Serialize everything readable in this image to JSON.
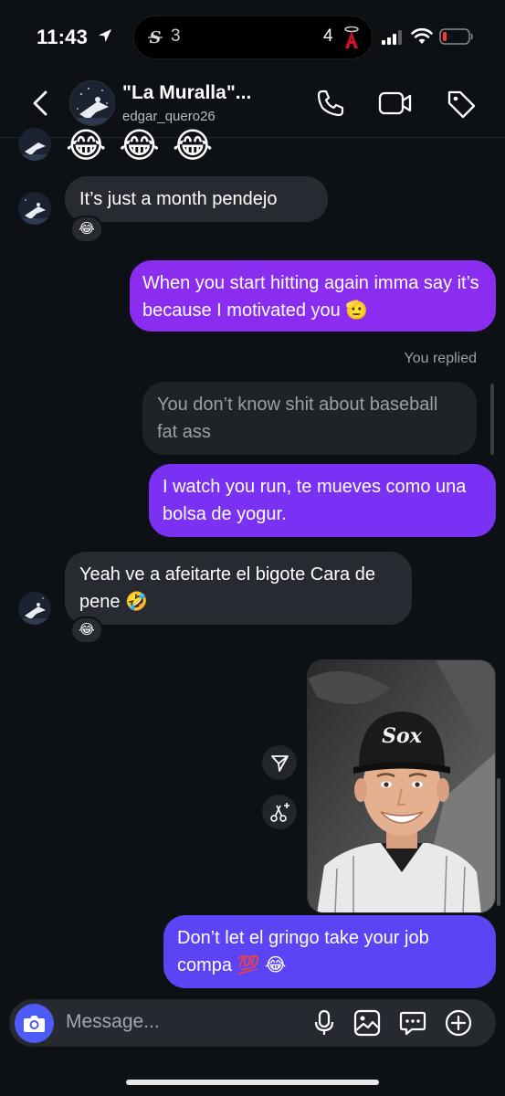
{
  "status_bar": {
    "time": "11:43",
    "score_left": "3",
    "score_right": "4"
  },
  "header": {
    "name": "\"La Muralla\"...",
    "username": "edgar_quero26"
  },
  "messages": {
    "top_emojis": "😂😂😂",
    "m1": "It’s just a month pendejo",
    "m1_reaction": "😂",
    "m2": "When you start hitting again imma say it’s because I motivated you 🫡",
    "you_replied_label": "You replied",
    "replied_to": "You don’t know shit about baseball fat ass",
    "m3": "I watch you run, te mueves como una bolsa de yogur.",
    "m4": "Yeah ve a afeitarte el bigote Cara de pene 🤣",
    "m4_reaction": "😂",
    "m5": "Don’t let el gringo take your job compa 💯 😂"
  },
  "composer": {
    "placeholder": "Message..."
  },
  "colors": {
    "background": "#0d1116",
    "received_bubble": "#272b31",
    "sent_purple": "#8a2df0",
    "sent_indigo": "#5a44f4",
    "camera_button": "#4d5cf7"
  },
  "icons": [
    "location-arrow-icon",
    "white-sox-logo-icon",
    "angels-logo-icon",
    "signal-icon",
    "wifi-icon",
    "battery-icon",
    "back-chevron-icon",
    "phone-icon",
    "video-icon",
    "tag-icon",
    "send-icon",
    "scissors-sparkle-icon",
    "camera-icon",
    "microphone-icon",
    "gallery-icon",
    "sticker-icon",
    "plus-icon"
  ]
}
